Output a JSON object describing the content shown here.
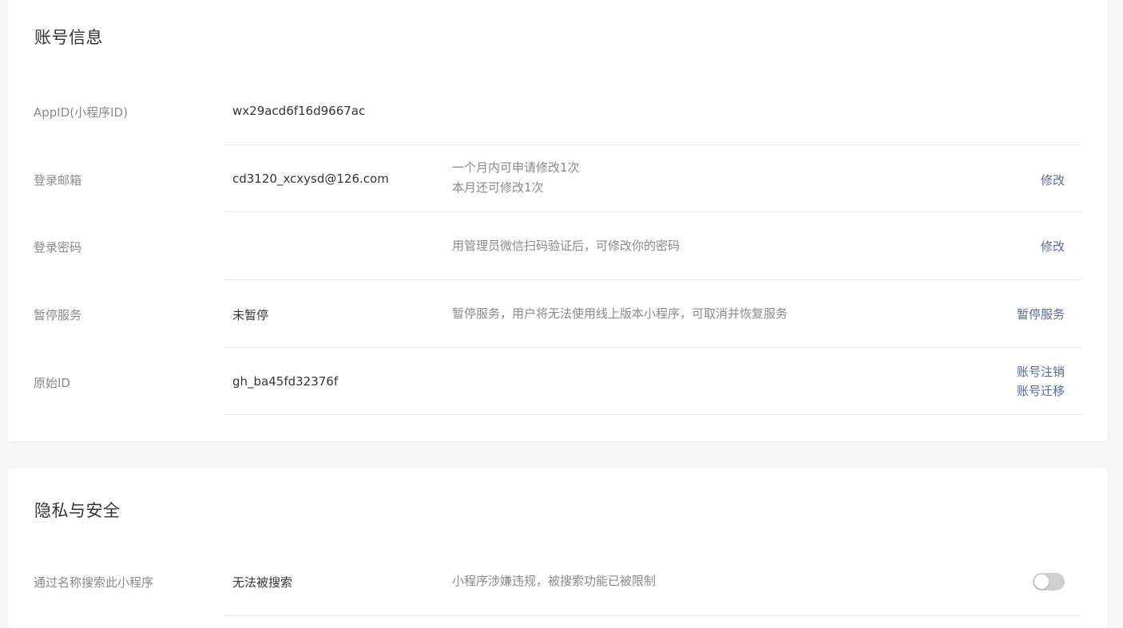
{
  "account_section": {
    "title": "账号信息",
    "rows": [
      {
        "label": "AppID(小程序ID)",
        "value": "wx29acd6f16d9667ac"
      },
      {
        "label": "登录邮箱",
        "value": "cd3120_xcxysd@126.com",
        "desc_line1": "一个月内可申请修改1次",
        "desc_line2": "本月还可修改1次",
        "action": "修改"
      },
      {
        "label": "登录密码",
        "desc": "用管理员微信扫码验证后，可修改你的密码",
        "action": "修改"
      },
      {
        "label": "暂停服务",
        "value": "未暂停",
        "desc": "暂停服务，用户将无法使用线上版本小程序，可取消并恢复服务",
        "action": "暂停服务"
      },
      {
        "label": "原始ID",
        "value": "gh_ba45fd32376f",
        "action1": "账号注销",
        "action2": "账号迁移"
      }
    ]
  },
  "privacy_section": {
    "title": "隐私与安全",
    "rows": [
      {
        "label": "通过名称搜索此小程序",
        "value": "无法被搜索",
        "desc": "小程序涉嫌违规，被搜索功能已被限制",
        "toggle_on": false
      }
    ]
  },
  "colors": {
    "link": "#576b95",
    "label": "#8a8a8a",
    "text": "#353535",
    "toggle_off": "#cfcfcf"
  }
}
